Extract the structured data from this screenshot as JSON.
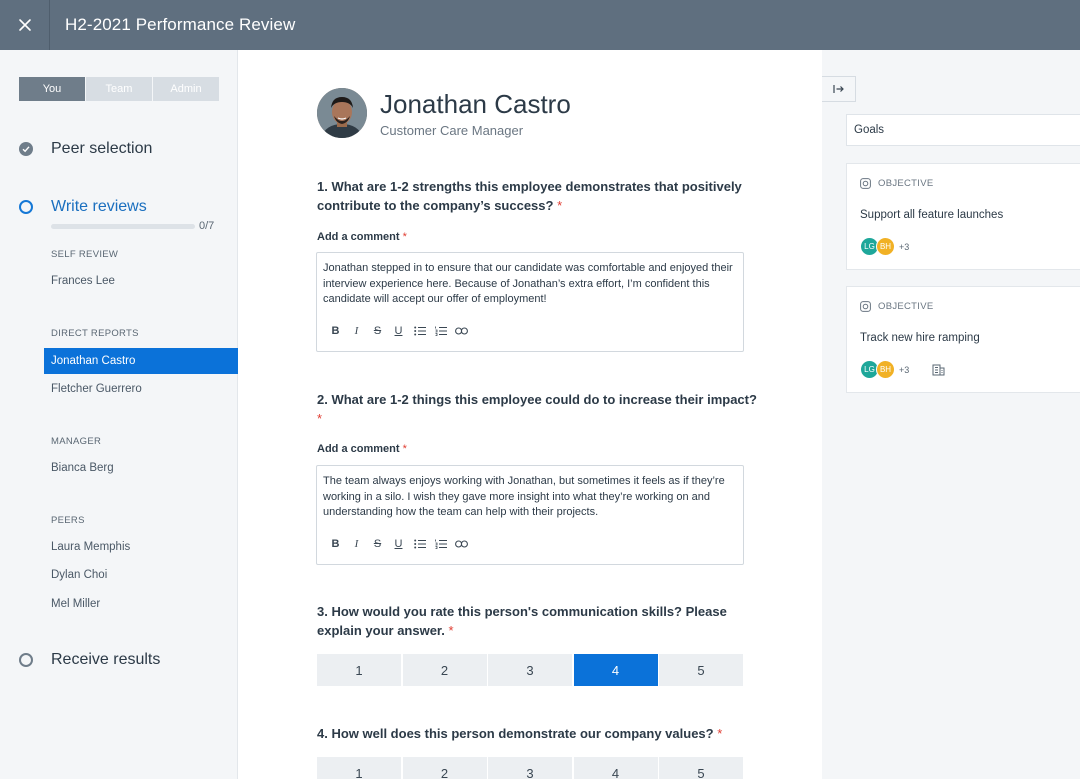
{
  "header": {
    "title": "H2-2021 Performance Review"
  },
  "sidebar": {
    "segments": [
      "You",
      "Team",
      "Admin"
    ],
    "steps": {
      "peer_selection": "Peer selection",
      "write_reviews": "Write reviews",
      "receive_results": "Receive results"
    },
    "progress": {
      "text": "0/7",
      "value": 0
    },
    "sections": {
      "self_review": {
        "heading": "SELF REVIEW",
        "items": [
          "Frances Lee"
        ]
      },
      "direct_reports": {
        "heading": "DIRECT REPORTS",
        "items": [
          "Jonathan Castro",
          "Fletcher Guerrero"
        ]
      },
      "manager": {
        "heading": "MANAGER",
        "items": [
          "Bianca Berg"
        ]
      },
      "peers": {
        "heading": "PEERS",
        "items": [
          "Laura Memphis",
          "Dylan Choi",
          "Mel Miller"
        ]
      }
    }
  },
  "main": {
    "employee": {
      "name": "Jonathan Castro",
      "role": "Customer Care Manager"
    },
    "required_mark": "*",
    "comment_label": "Add a comment",
    "questions": [
      {
        "text": "1. What are 1-2 strengths this employee demonstrates that positively contribute to the company’s success?",
        "comment": "Jonathan stepped in to ensure that our candidate was comfortable and enjoyed their interview experience here. Because of Jonathan’s extra effort, I’m confident this candidate will accept our offer of employment!"
      },
      {
        "text": "2. What are 1-2 things this employee could do to increase their impact?",
        "comment": "The team always enjoys working with Jonathan, but sometimes it feels as if they’re working in a silo. I wish they gave more insight into what they’re working on and understanding how the team can help with their projects."
      },
      {
        "text": "3. How would you rate this person's communication skills? Please explain your answer.",
        "rating": 4
      },
      {
        "text": "4. How well does this person demonstrate our company values?"
      }
    ],
    "rating_options": [
      "1",
      "2",
      "3",
      "4",
      "5"
    ],
    "toolbar": {
      "bold": "B",
      "italic": "I",
      "strike": "S",
      "underline": "U"
    }
  },
  "right_panel": {
    "select": "Goals",
    "cards": [
      {
        "kind": "OBJECTIVE",
        "title": "Support all feature launches",
        "chips": [
          "LG",
          "BH"
        ],
        "more": "+3"
      },
      {
        "kind": "OBJECTIVE",
        "title": "Track new hire ramping",
        "chips": [
          "LG",
          "BH"
        ],
        "more": "+3"
      }
    ]
  },
  "colors": {
    "accent": "#0b72d9",
    "header": "#5f6f7f",
    "chip_lg": "#1ea79a",
    "chip_bh": "#f1b125",
    "required": "#e03c31"
  }
}
